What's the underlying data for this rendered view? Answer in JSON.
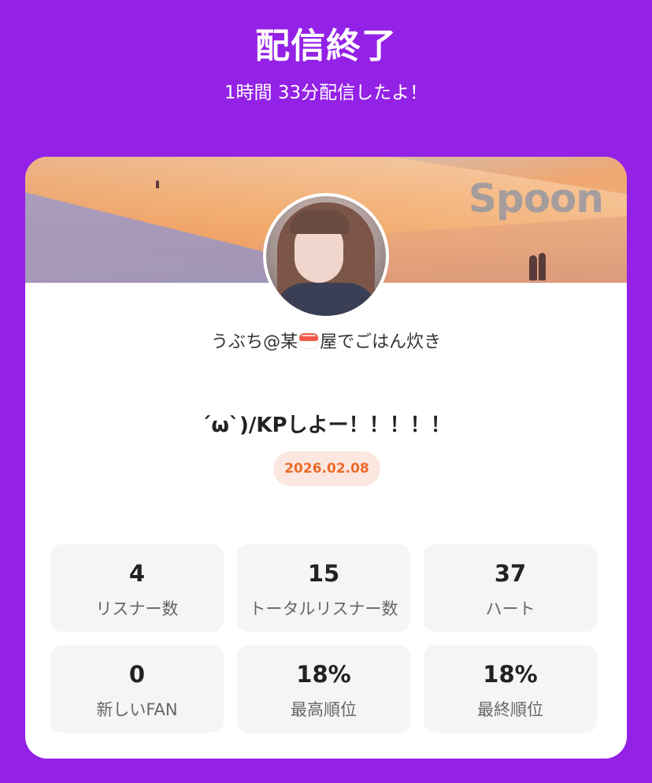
{
  "header": {
    "title": "配信終了",
    "subtitle": "1時間 33分配信したよ！"
  },
  "card": {
    "logo": "Spoon",
    "dj_name_prefix": "うぶち@某",
    "dj_name_icon": "sushi-icon",
    "dj_name_suffix": "屋でごはん炊き",
    "room_title": "´ω`)/KPしよー！！！！！",
    "date": "2026.02.08",
    "stats": [
      {
        "value": "4",
        "label": "リスナー数"
      },
      {
        "value": "15",
        "label": "トータルリスナー数"
      },
      {
        "value": "37",
        "label": "ハート"
      },
      {
        "value": "0",
        "label": "新しいFAN"
      },
      {
        "value": "18%",
        "label": "最高順位"
      },
      {
        "value": "18%",
        "label": "最終順位"
      }
    ]
  },
  "colors": {
    "background": "#9421e6",
    "date_text": "#ec6a2a",
    "date_bg": "#fbe7df"
  }
}
